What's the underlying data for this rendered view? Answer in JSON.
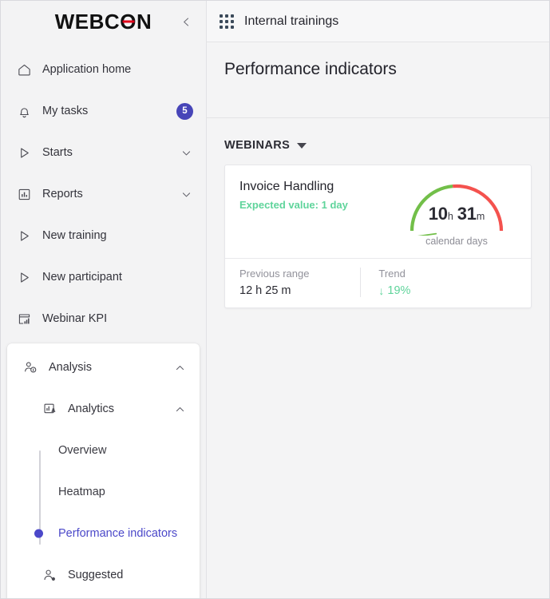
{
  "sidebar": {
    "logo": {
      "part1": "WEBC",
      "part2": "O",
      "part3": "N"
    },
    "collapse_tooltip": "Collapse",
    "items": [
      {
        "label": "Application home",
        "icon": "home-icon"
      },
      {
        "label": "My tasks",
        "icon": "bell-icon",
        "badge": "5"
      },
      {
        "label": "Starts",
        "icon": "play-outline-icon",
        "chevron": "down"
      },
      {
        "label": "Reports",
        "icon": "report-chart-icon",
        "chevron": "down"
      },
      {
        "label": "New training",
        "icon": "play-outline-icon"
      },
      {
        "label": "New participant",
        "icon": "play-outline-icon"
      },
      {
        "label": "Webinar KPI",
        "icon": "kpi-board-icon"
      }
    ],
    "analysis": {
      "label": "Analysis",
      "icon": "people-info-icon",
      "chevron": "up",
      "analytics": {
        "label": "Analytics",
        "icon": "analytics-icon",
        "chevron": "up",
        "children": [
          {
            "label": "Overview",
            "active": false
          },
          {
            "label": "Heatmap",
            "active": false
          },
          {
            "label": "Performance indicators",
            "active": true
          }
        ]
      },
      "suggested": {
        "label": "Suggested",
        "icon": "people-add-icon"
      }
    }
  },
  "topbar": {
    "waffle_icon": "app-grid-icon",
    "title": "Internal trainings"
  },
  "page": {
    "title": "Performance indicators"
  },
  "group": {
    "title": "WEBINARS",
    "caret_icon": "caret-down-icon"
  },
  "kpi": {
    "name": "Invoice Handling",
    "expected": "Expected value: 1 day",
    "gauge": {
      "value_number": "10",
      "value_unit": "h",
      "value_number2": "31",
      "value_unit2": "m",
      "caption": "calendar days",
      "green_end_deg": 95,
      "needle_deg": 188,
      "green_color": "#72bf49",
      "red_color": "#f4524e"
    },
    "footer": {
      "previous_label": "Previous range",
      "previous_value": "12 h 25 m",
      "trend_label": "Trend",
      "trend_arrow": "↓",
      "trend_value": "19%"
    }
  },
  "colors": {
    "accent": "#4b48c9",
    "badge": "#4745b8",
    "good_green": "#5fd49b",
    "gauge_green": "#72bf49",
    "gauge_red": "#f4524e",
    "logo_red": "#e2001a"
  }
}
